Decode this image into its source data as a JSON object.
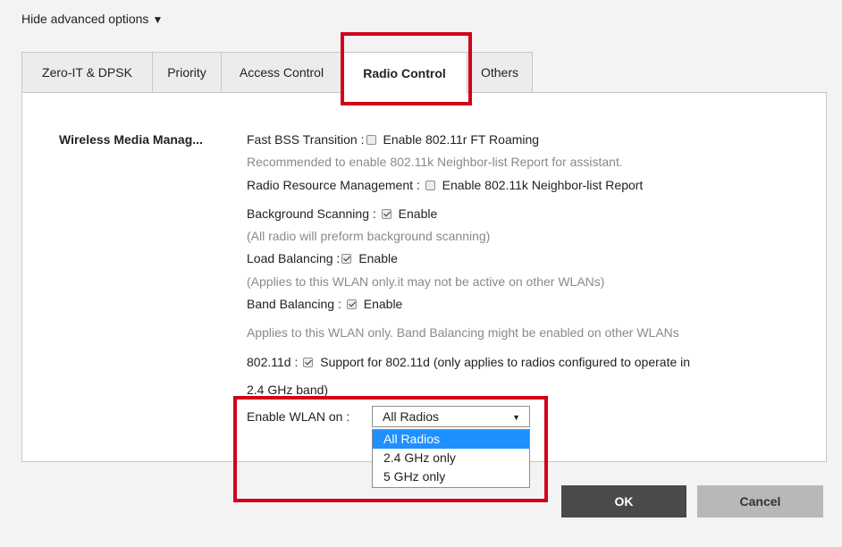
{
  "toggle": {
    "label": "Hide advanced options",
    "indicator": "▼"
  },
  "tabs": [
    {
      "label": "Zero-IT & DPSK",
      "active": false
    },
    {
      "label": "Priority",
      "active": false
    },
    {
      "label": "Access Control",
      "active": false
    },
    {
      "label": "Radio Control",
      "active": true
    },
    {
      "label": "Others",
      "active": false
    }
  ],
  "section": {
    "label": "Wireless Media Manag..."
  },
  "settings": {
    "fast_bss": {
      "label": "Fast BSS Transition :",
      "checked": false,
      "option": "Enable 802.11r FT Roaming"
    },
    "fast_bss_note": "Recommended to enable 802.11k Neighbor-list Report for assistant.",
    "rrm": {
      "label": "Radio Resource Management :",
      "checked": false,
      "option": "Enable 802.11k Neighbor-list Report"
    },
    "bg_scan": {
      "label": "Background Scanning :",
      "checked": true,
      "option": "Enable"
    },
    "bg_scan_note": "(All radio will preform background scanning)",
    "load_bal": {
      "label": "Load Balancing :",
      "checked": true,
      "option": "Enable"
    },
    "load_bal_note": "(Applies to this WLAN only.it may not be active on other WLANs)",
    "band_bal": {
      "label": "Band Balancing :",
      "checked": true,
      "option": "Enable"
    },
    "band_bal_note": "Applies to this WLAN only. Band Balancing might be enabled on other WLANs",
    "d80211": {
      "label": "802.11d :",
      "checked": true,
      "option": "Support for 802.11d (only applies to radios configured to operate in"
    },
    "d80211_cont": "2.4 GHz band)",
    "enable_wlan": {
      "label": "Enable WLAN on :",
      "selected": "All Radios",
      "options": [
        "All Radios",
        "2.4 GHz only",
        "5 GHz only"
      ]
    }
  },
  "buttons": {
    "ok": "OK",
    "cancel": "Cancel"
  },
  "colors": {
    "highlight": "#d0021b",
    "selected_option": "#1e90ff",
    "ok_button": "#4a4a4a",
    "cancel_button": "#b8b8b8"
  }
}
